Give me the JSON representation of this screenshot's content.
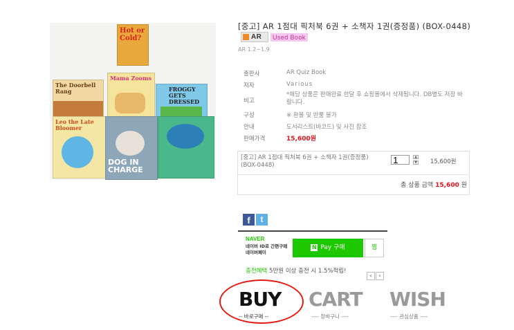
{
  "product": {
    "title": "[중고] AR 1점대 픽처북 6권 + 소책자 1권(증정품) (BOX-0448)",
    "badge_ar": "AR",
    "badge_used": "Used Book",
    "ar_level": "AR 1.2~1.9",
    "image_books": [
      "Hot or Cold?",
      "Mama Zooms",
      "The Doorbell Rang",
      "FROGGY GETS DRESSED",
      "Leo the Late Bloomer",
      "DOG IN CHARGE"
    ]
  },
  "info": [
    {
      "label": "출판사",
      "value": "AR Quiz Book"
    },
    {
      "label": "저자",
      "value": "Various"
    },
    {
      "label": "비고",
      "value": "*해당 상품은 판매완료 한달 후 쇼핑몰에서 삭제됩니다. DB별도 저장 바랍니다."
    },
    {
      "label": "구성",
      "value": "※ 환불 및 반품 불가"
    },
    {
      "label": "안내",
      "value": "도서리스트(바코드) 및 사진 참조"
    },
    {
      "label": "판매가격",
      "value": "15,600원"
    }
  ],
  "option": {
    "name": "[중고] AR 1점대 픽처북 6권 + 소책자 1권(증정품) (BOX-0448)",
    "qty": "1",
    "price": "15,600원",
    "total_label": "총 상품 금액",
    "total_value": "15,600",
    "total_unit": "원"
  },
  "naverpay": {
    "brand": "NAVER",
    "desc": "네이버 ID로 간편구매 네이버페이",
    "pay_label": "Pay 구매",
    "zzim": "찜",
    "charge_green": "충전혜택",
    "charge_text": "5만원 이상 충전 시 1.5%적립!"
  },
  "actions": {
    "buy": "BUY",
    "buy_sub": "-- 바로구매 --",
    "cart": "CART",
    "cart_sub": "---- 장바구니 ----",
    "wish": "WISH",
    "wish_sub": "---- 관심상품 ----"
  },
  "colors": {
    "price_red": "#e0141e",
    "naver_green": "#1ec800",
    "highlight_circle": "#e41b13"
  }
}
